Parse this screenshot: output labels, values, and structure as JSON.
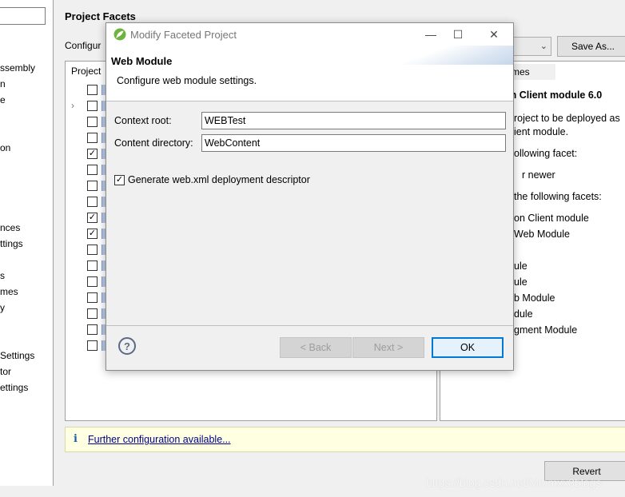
{
  "background": {
    "page_title": "Project Facets",
    "configuration_label": "Configur",
    "save_as_label": "Save As...",
    "revert_label": "Revert",
    "left_nav_items": [
      {
        "label": "ssembly"
      },
      {
        "label": "n"
      },
      {
        "label": "e"
      },
      {
        "label": "on"
      },
      {
        "label": "nces"
      },
      {
        "label": "ttings"
      },
      {
        "label": "s"
      },
      {
        "label": "mes"
      },
      {
        "label": "y"
      },
      {
        "label": "Settings"
      },
      {
        "label": "tor"
      },
      {
        "label": "ettings"
      }
    ],
    "facet_tree": {
      "header": "Project",
      "rows": [
        {
          "checked": false,
          "expandable": false
        },
        {
          "checked": false,
          "expandable": true
        },
        {
          "checked": false,
          "expandable": false
        },
        {
          "checked": false,
          "expandable": false
        },
        {
          "checked": true,
          "expandable": false
        },
        {
          "checked": false,
          "expandable": false
        },
        {
          "checked": false,
          "expandable": false
        },
        {
          "checked": false,
          "expandable": false
        },
        {
          "checked": true,
          "expandable": false
        },
        {
          "checked": true,
          "expandable": false
        },
        {
          "checked": false,
          "expandable": false
        },
        {
          "checked": false,
          "expandable": false
        },
        {
          "checked": false,
          "expandable": false
        },
        {
          "checked": false,
          "expandable": false
        },
        {
          "checked": false,
          "expandable": false
        },
        {
          "checked": false,
          "expandable": false
        },
        {
          "checked": false,
          "expandable": false
        }
      ]
    },
    "details": {
      "tab_label": "mes",
      "title": "on Client module 6.0",
      "lines": [
        "roject to be deployed as",
        "ient module.",
        "ollowing facet:",
        "r newer",
        "the following facets:",
        "on Client module",
        "Web Module",
        "ule",
        "ule",
        "b Module",
        "dule",
        "gment Module"
      ]
    },
    "info_link": "Further configuration available...",
    "watermark": "https://blog.csdn.net/Mmmxx3blogs"
  },
  "dialog": {
    "title": "Modify Faceted Project",
    "header_title": "Web Module",
    "header_description": "Configure web module settings.",
    "context_root_label": "Context root:",
    "context_root_value": "WEBTest",
    "content_directory_label": "Content directory:",
    "content_directory_value": "WebContent",
    "generate_descriptor_label": "Generate web.xml deployment descriptor",
    "generate_descriptor_checked": true,
    "help_glyph": "?",
    "buttons": {
      "back": "< Back",
      "next": "Next >",
      "ok": "OK"
    },
    "window_controls": {
      "minimize": "—",
      "maximize": "☐",
      "close": "✕"
    }
  },
  "colors": {
    "accent": "#0078d7",
    "link": "#00008b",
    "info_background": "#ffffe1",
    "spring_green": "#6db33f"
  },
  "icons": [
    "spring-logo-icon",
    "minimize-icon",
    "maximize-icon",
    "close-icon",
    "help-icon",
    "info-icon",
    "chevron-right-icon",
    "checkbox-icon",
    "facet-icon"
  ]
}
